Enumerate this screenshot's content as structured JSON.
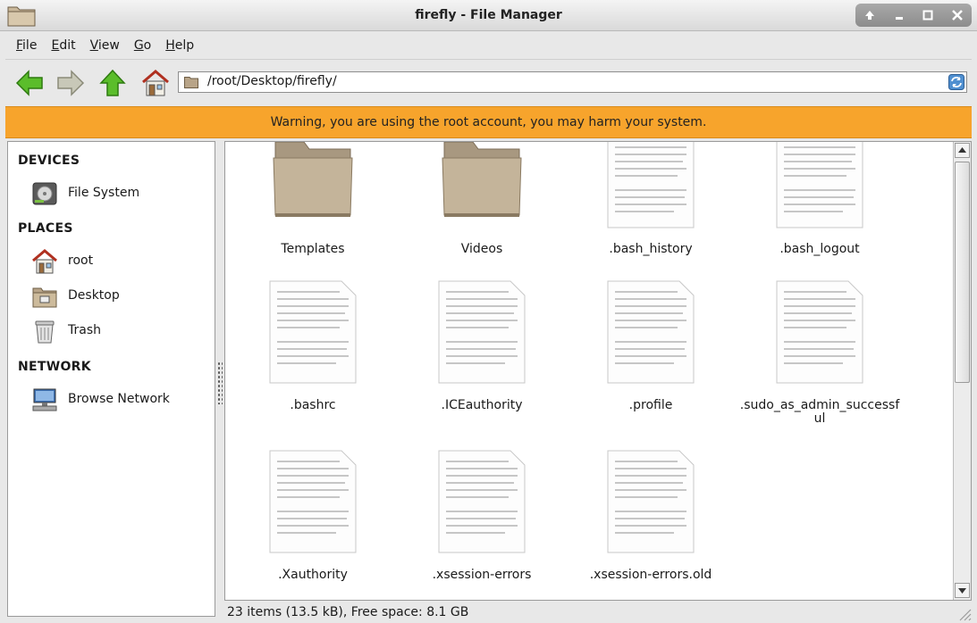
{
  "window": {
    "title": "firefly - File Manager"
  },
  "menu": {
    "items": [
      "File",
      "Edit",
      "View",
      "Go",
      "Help"
    ]
  },
  "toolbar": {
    "location_path": "/root/Desktop/firefly/"
  },
  "warning": {
    "text": "Warning, you are using the root account, you may harm your system.",
    "color": "#f7a42c"
  },
  "sidebar": {
    "sections": [
      {
        "heading": "DEVICES",
        "items": [
          {
            "label": "File System",
            "icon": "harddisk-icon"
          }
        ]
      },
      {
        "heading": "PLACES",
        "items": [
          {
            "label": "root",
            "icon": "home-icon"
          },
          {
            "label": "Desktop",
            "icon": "desktop-folder-icon"
          },
          {
            "label": "Trash",
            "icon": "trash-icon"
          }
        ]
      },
      {
        "heading": "NETWORK",
        "items": [
          {
            "label": "Browse Network",
            "icon": "network-icon"
          }
        ]
      }
    ]
  },
  "files": [
    {
      "name": "Templates",
      "type": "folder"
    },
    {
      "name": "Videos",
      "type": "folder"
    },
    {
      "name": ".bash_history",
      "type": "text"
    },
    {
      "name": ".bash_logout",
      "type": "text"
    },
    {
      "name": ".bashrc",
      "type": "text"
    },
    {
      "name": ".ICEauthority",
      "type": "text"
    },
    {
      "name": ".profile",
      "type": "text"
    },
    {
      "name": ".sudo_as_admin_successful",
      "type": "text"
    },
    {
      "name": ".Xauthority",
      "type": "text"
    },
    {
      "name": ".xsession-errors",
      "type": "text"
    },
    {
      "name": ".xsession-errors.old",
      "type": "text"
    }
  ],
  "status": {
    "text": "23 items (13.5 kB), Free space: 8.1 GB"
  }
}
